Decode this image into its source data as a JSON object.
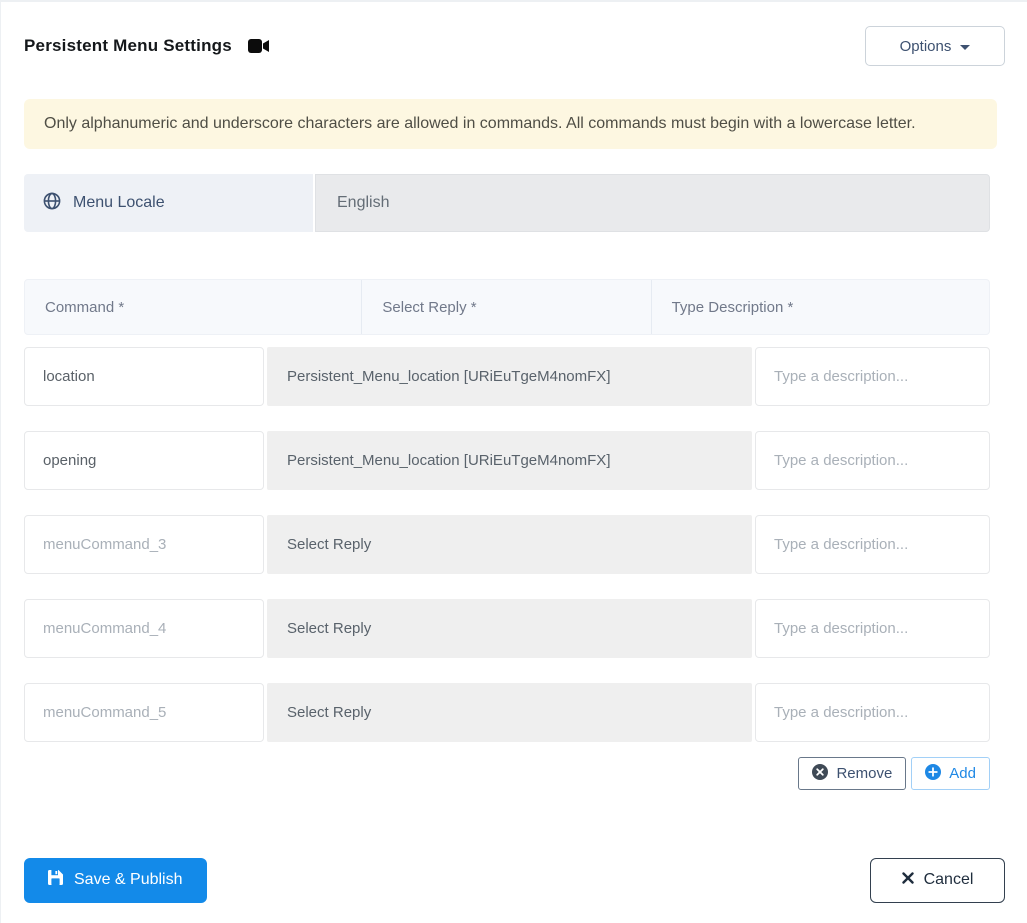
{
  "header": {
    "title": "Persistent Menu Settings",
    "options_label": "Options"
  },
  "alert": {
    "text": "Only alphanumeric and underscore characters are allowed in commands. All commands must begin with a lowercase letter."
  },
  "locale": {
    "label": "Menu Locale",
    "value": "English"
  },
  "table": {
    "headers": {
      "command": "Command *",
      "reply": "Select Reply *",
      "description": "Type Description *"
    },
    "description_placeholder": "Type a description...",
    "rows": [
      {
        "command_value": "location",
        "reply": "Persistent_Menu_location [URiEuTgeM4nomFX]"
      },
      {
        "command_value": "opening",
        "reply": "Persistent_Menu_location [URiEuTgeM4nomFX]"
      },
      {
        "command_placeholder": "menuCommand_3",
        "reply": "Select Reply"
      },
      {
        "command_placeholder": "menuCommand_4",
        "reply": "Select Reply"
      },
      {
        "command_placeholder": "menuCommand_5",
        "reply": "Select Reply"
      }
    ],
    "remove_label": "Remove",
    "add_label": "Add"
  },
  "footer": {
    "save_label": "Save & Publish",
    "cancel_label": "Cancel"
  },
  "colors": {
    "primary_blue": "#138ae9",
    "accent_blue": "#1e88e5",
    "alert_bg": "#fdf7e1",
    "select_bg": "#efefef",
    "slate_text": "#3d5170"
  }
}
